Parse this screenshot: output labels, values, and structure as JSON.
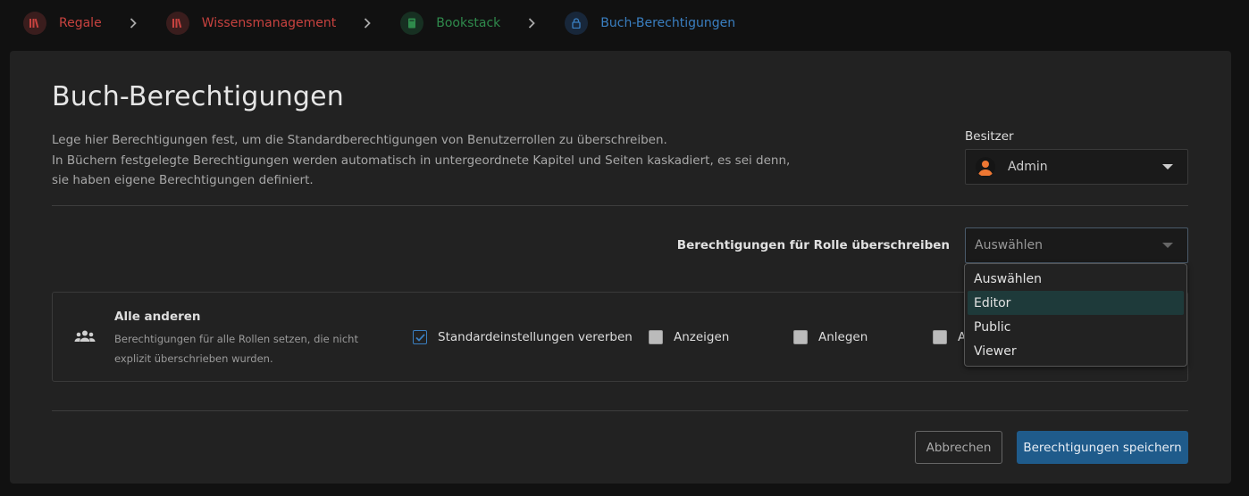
{
  "breadcrumbs": [
    {
      "label": "Regale",
      "icon": "bookshelf-icon"
    },
    {
      "label": "Wissensmanagement",
      "icon": "bookshelf-icon"
    },
    {
      "label": "Bookstack",
      "icon": "book-icon"
    },
    {
      "label": "Buch-Berechtigungen",
      "icon": "lock-icon"
    }
  ],
  "page": {
    "title": "Buch-Berechtigungen",
    "description_lines": [
      "Lege hier Berechtigungen fest, um die Standardberechtigungen von Benutzerrollen zu überschreiben.",
      "In Büchern festgelegte Berechtigungen werden automatisch in untergeordnete Kapitel und Seiten kaskadiert, es sei denn, sie haben eigene Berechtigungen definiert."
    ]
  },
  "owner": {
    "label": "Besitzer",
    "value": "Admin"
  },
  "role_override": {
    "label": "Berechtigungen für Rolle überschreiben",
    "selected": "Auswählen",
    "options": [
      "Auswählen",
      "Editor",
      "Public",
      "Viewer"
    ],
    "highlighted": "Editor"
  },
  "everyone_else": {
    "title": "Alle anderen",
    "subtitle": "Berechtigungen für alle Rollen setzen, die nicht explizit überschrieben wurden.",
    "checkboxes": [
      {
        "label": "Standardeinstellungen vererben",
        "checked": true
      },
      {
        "label": "Anzeigen",
        "checked": false
      },
      {
        "label": "Anlegen",
        "checked": false
      },
      {
        "label": "A",
        "checked": false
      }
    ]
  },
  "actions": {
    "cancel": "Abbrechen",
    "save": "Berechtigungen speichern"
  },
  "colors": {
    "shelf": "#c7423f",
    "book": "#2f8a4c",
    "page": "#3a7fc1",
    "primary_button": "#1f5b8b"
  }
}
